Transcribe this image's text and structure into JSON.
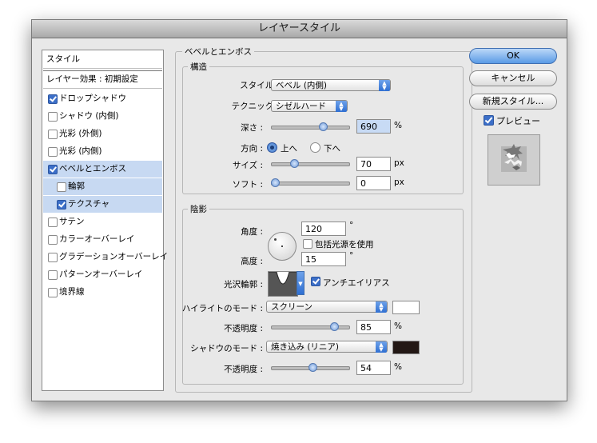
{
  "window": {
    "title": "レイヤースタイル"
  },
  "styles_panel": {
    "header": "スタイル",
    "blend_options": "レイヤー効果 : 初期設定",
    "items": [
      {
        "label": "ドロップシャドウ",
        "checked": true
      },
      {
        "label": "シャドウ (内側)",
        "checked": false
      },
      {
        "label": "光彩 (外側)",
        "checked": false
      },
      {
        "label": "光彩 (内側)",
        "checked": false
      },
      {
        "label": "ベベルとエンボス",
        "checked": true,
        "selected": true
      },
      {
        "label": "輪郭",
        "checked": false,
        "sub": true
      },
      {
        "label": "テクスチャ",
        "checked": true,
        "sub": true
      },
      {
        "label": "サテン",
        "checked": false
      },
      {
        "label": "カラーオーバーレイ",
        "checked": false
      },
      {
        "label": "グラデーションオーバーレイ",
        "checked": false
      },
      {
        "label": "パターンオーバーレイ",
        "checked": false
      },
      {
        "label": "境界線",
        "checked": false
      }
    ]
  },
  "bevel": {
    "section_title": "ベベルとエンボス",
    "structure": {
      "title": "構造",
      "style_label": "スタイル :",
      "style_value": "ベベル (内側)",
      "technique_label": "テクニック :",
      "technique_value": "シゼルハード",
      "depth_label": "深さ :",
      "depth_value": "690",
      "depth_unit": "%",
      "direction_label": "方向 :",
      "direction_up": "上へ",
      "direction_down": "下へ",
      "direction_selected": "up",
      "size_label": "サイズ :",
      "size_value": "70",
      "size_unit": "px",
      "soften_label": "ソフト :",
      "soften_value": "0",
      "soften_unit": "px"
    },
    "shading": {
      "title": "陰影",
      "angle_label": "角度 :",
      "angle_value": "120",
      "angle_unit": "°",
      "global_light_label": "包括光源を使用",
      "global_light_checked": false,
      "altitude_label": "高度 :",
      "altitude_value": "15",
      "altitude_unit": "°",
      "gloss_label": "光沢輪郭 :",
      "antialias_label": "アンチエイリアス",
      "antialias_checked": true,
      "highlight_mode_label": "ハイライトのモード :",
      "highlight_mode_value": "スクリーン",
      "highlight_color": "#ffffff",
      "highlight_opacity_label": "不透明度 :",
      "highlight_opacity_value": "85",
      "highlight_opacity_unit": "%",
      "shadow_mode_label": "シャドウのモード :",
      "shadow_mode_value": "焼き込み (リニア)",
      "shadow_color": "#231815",
      "shadow_opacity_label": "不透明度 :",
      "shadow_opacity_value": "54",
      "shadow_opacity_unit": "%"
    }
  },
  "buttons": {
    "ok": "OK",
    "cancel": "キャンセル",
    "new_style": "新規スタイル...",
    "preview_label": "プレビュー",
    "preview_checked": true
  },
  "slider_levels": {
    "depth": 0.69,
    "size": 0.28,
    "soften": 0.0,
    "highlight_opacity": 0.85,
    "shadow_opacity": 0.54
  }
}
